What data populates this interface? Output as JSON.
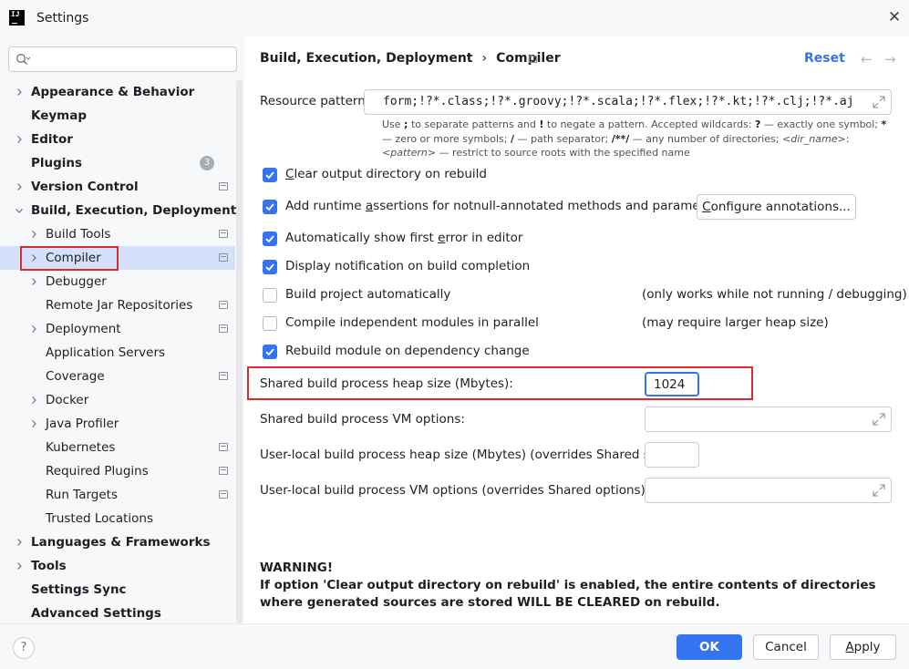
{
  "window": {
    "title": "Settings",
    "logo_text": "IJ"
  },
  "sidebar": {
    "search_placeholder": "",
    "items": [
      {
        "label": "Appearance & Behavior",
        "bold": true,
        "chevron": "right",
        "indent": 0
      },
      {
        "label": "Keymap",
        "bold": true,
        "chevron": "none",
        "indent": 0
      },
      {
        "label": "Editor",
        "bold": true,
        "chevron": "right",
        "indent": 0
      },
      {
        "label": "Plugins",
        "bold": true,
        "chevron": "none",
        "indent": 0,
        "badge": "3"
      },
      {
        "label": "Version Control",
        "bold": true,
        "chevron": "right",
        "indent": 0,
        "project_icon": true
      },
      {
        "label": "Build, Execution, Deployment",
        "bold": true,
        "chevron": "down",
        "indent": 0
      },
      {
        "label": "Build Tools",
        "bold": false,
        "chevron": "right",
        "indent": 1,
        "project_icon": true
      },
      {
        "label": "Compiler",
        "bold": false,
        "chevron": "right",
        "indent": 1,
        "project_icon": true,
        "selected": true
      },
      {
        "label": "Debugger",
        "bold": false,
        "chevron": "right",
        "indent": 1
      },
      {
        "label": "Remote Jar Repositories",
        "bold": false,
        "chevron": "none",
        "indent": 1,
        "project_icon": true
      },
      {
        "label": "Deployment",
        "bold": false,
        "chevron": "right",
        "indent": 1,
        "project_icon": true
      },
      {
        "label": "Application Servers",
        "bold": false,
        "chevron": "none",
        "indent": 1
      },
      {
        "label": "Coverage",
        "bold": false,
        "chevron": "none",
        "indent": 1,
        "project_icon": true
      },
      {
        "label": "Docker",
        "bold": false,
        "chevron": "right",
        "indent": 1
      },
      {
        "label": "Java Profiler",
        "bold": false,
        "chevron": "right",
        "indent": 1
      },
      {
        "label": "Kubernetes",
        "bold": false,
        "chevron": "none",
        "indent": 1,
        "project_icon": true
      },
      {
        "label": "Required Plugins",
        "bold": false,
        "chevron": "none",
        "indent": 1,
        "project_icon": true
      },
      {
        "label": "Run Targets",
        "bold": false,
        "chevron": "none",
        "indent": 1,
        "project_icon": true
      },
      {
        "label": "Trusted Locations",
        "bold": false,
        "chevron": "none",
        "indent": 1
      },
      {
        "label": "Languages & Frameworks",
        "bold": true,
        "chevron": "right",
        "indent": 0
      },
      {
        "label": "Tools",
        "bold": true,
        "chevron": "right",
        "indent": 0
      },
      {
        "label": "Settings Sync",
        "bold": true,
        "chevron": "none",
        "indent": 0
      },
      {
        "label": "Advanced Settings",
        "bold": true,
        "chevron": "none",
        "indent": 0
      }
    ]
  },
  "header": {
    "breadcrumb": [
      "Build, Execution, Deployment",
      "Compiler"
    ],
    "separator": "›",
    "reset_label": "Reset",
    "back_arrow": "←",
    "forward_arrow": "→"
  },
  "compiler": {
    "resource_patterns": {
      "label": "Resource patterns:",
      "value": "form;!?*.class;!?*.groovy;!?*.scala;!?*.flex;!?*.kt;!?*.clj;!?*.aj"
    },
    "help": {
      "p1": "Use ",
      "b1": ";",
      "p2": " to separate patterns and ",
      "b2": "!",
      "p3": " to negate a pattern. Accepted wildcards: ",
      "b3": "?",
      "p4": " — exactly one symbol; ",
      "b4": "*",
      "p5": " — zero or more symbols; ",
      "b5": "/",
      "p6": " — path separator; ",
      "b6": "/**/",
      "p7": " — any number of directories; ",
      "i1": "<dir_name>",
      "p8": ":",
      "i2": "<pattern>",
      "p9": " — restrict to source roots with the specified name"
    },
    "options": [
      {
        "pre": "",
        "mn": "C",
        "post": "lear output directory on rebuild",
        "checked": true
      },
      {
        "pre": "Add runtime ",
        "mn": "a",
        "post": "ssertions for notnull-annotated methods and parameters",
        "checked": true
      },
      {
        "pre": "Automatically show first ",
        "mn": "e",
        "post": "rror in editor",
        "checked": true
      },
      {
        "pre": "Display notification on build completion",
        "mn": "",
        "post": "",
        "checked": true
      },
      {
        "pre": "Build project automatically",
        "mn": "",
        "post": "",
        "checked": false,
        "note": "(only works while not running / debugging)"
      },
      {
        "pre": "Compile independent modules in parallel",
        "mn": "",
        "post": "",
        "checked": false,
        "note": "(may require larger heap size)"
      },
      {
        "pre": "Rebuild module on dependency change",
        "mn": "",
        "post": "",
        "checked": true
      }
    ],
    "configure_button": {
      "mn": "C",
      "post": "onfigure annotations..."
    },
    "heap_size": {
      "label": "Shared build process heap size (Mbytes):",
      "value": "1024"
    },
    "vm_options": {
      "label": "Shared build process VM options:",
      "value": ""
    },
    "local_heap": {
      "label": "User-local build process heap size (Mbytes) (overrides Shared size):",
      "value": ""
    },
    "local_vm": {
      "label": "User-local build process VM options (overrides Shared options):",
      "value": ""
    },
    "warning": {
      "title": "WARNING!",
      "text": "If option 'Clear output directory on rebuild' is enabled, the entire contents of directories where generated sources are stored WILL BE CLEARED on rebuild."
    }
  },
  "footer": {
    "help_label": "?",
    "ok_label": "OK",
    "cancel_label": "Cancel",
    "apply_mn": "A",
    "apply_post": "pply"
  },
  "colors": {
    "accent": "#3574f0",
    "highlight_border": "#dc2b2f",
    "selection": "#d5e1fb",
    "sidebar_bg": "#f7f8fa"
  }
}
